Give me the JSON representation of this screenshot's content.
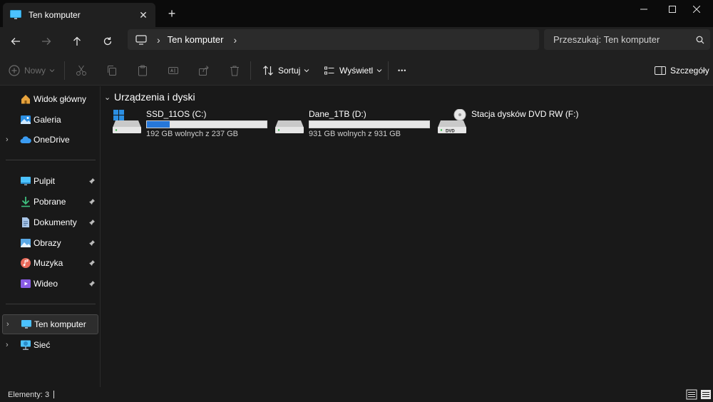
{
  "tab": {
    "title": "Ten komputer",
    "close_glyph": "✕",
    "new_tab_glyph": "+"
  },
  "address": {
    "chevron": "›",
    "location": "Ten komputer",
    "trailing_chevron": "›"
  },
  "search": {
    "placeholder": "Przeszukaj: Ten komputer"
  },
  "toolbar": {
    "new_label": "Nowy",
    "sort_label": "Sortuj",
    "view_label": "Wyświetl",
    "more_glyph": "•••",
    "details_label": "Szczegóły"
  },
  "sidebar": {
    "top": [
      {
        "label": "Widok główny",
        "icon": "home-icon"
      },
      {
        "label": "Galeria",
        "icon": "gallery-icon"
      },
      {
        "label": "OneDrive",
        "icon": "cloud-icon"
      }
    ],
    "quick": [
      {
        "label": "Pulpit",
        "icon": "desktop-icon"
      },
      {
        "label": "Pobrane",
        "icon": "download-icon"
      },
      {
        "label": "Dokumenty",
        "icon": "document-icon"
      },
      {
        "label": "Obrazy",
        "icon": "pictures-icon"
      },
      {
        "label": "Muzyka",
        "icon": "music-icon"
      },
      {
        "label": "Wideo",
        "icon": "video-icon"
      }
    ],
    "bottom": [
      {
        "label": "Ten komputer",
        "icon": "computer-icon",
        "selected": true
      },
      {
        "label": "Sieć",
        "icon": "network-icon"
      }
    ],
    "expander_glyph": "›"
  },
  "main": {
    "group_title": "Urządzenia i dyski",
    "group_chevron": "⌄",
    "drives": [
      {
        "name": "SSD_11OS (C:)",
        "info": "192 GB wolnych z 237 GB",
        "used_fraction": 0.19
      },
      {
        "name": "Dane_1TB (D:)",
        "info": "931 GB wolnych z 931 GB",
        "used_fraction": 0.0
      },
      {
        "name": "Stacja dysków DVD RW (F:)",
        "dvd_label": "DVD"
      }
    ]
  },
  "status": {
    "text": "Elementy: 3"
  },
  "colors": {
    "accent": "#2677d9",
    "background": "#191919",
    "toolbar": "#202020"
  }
}
